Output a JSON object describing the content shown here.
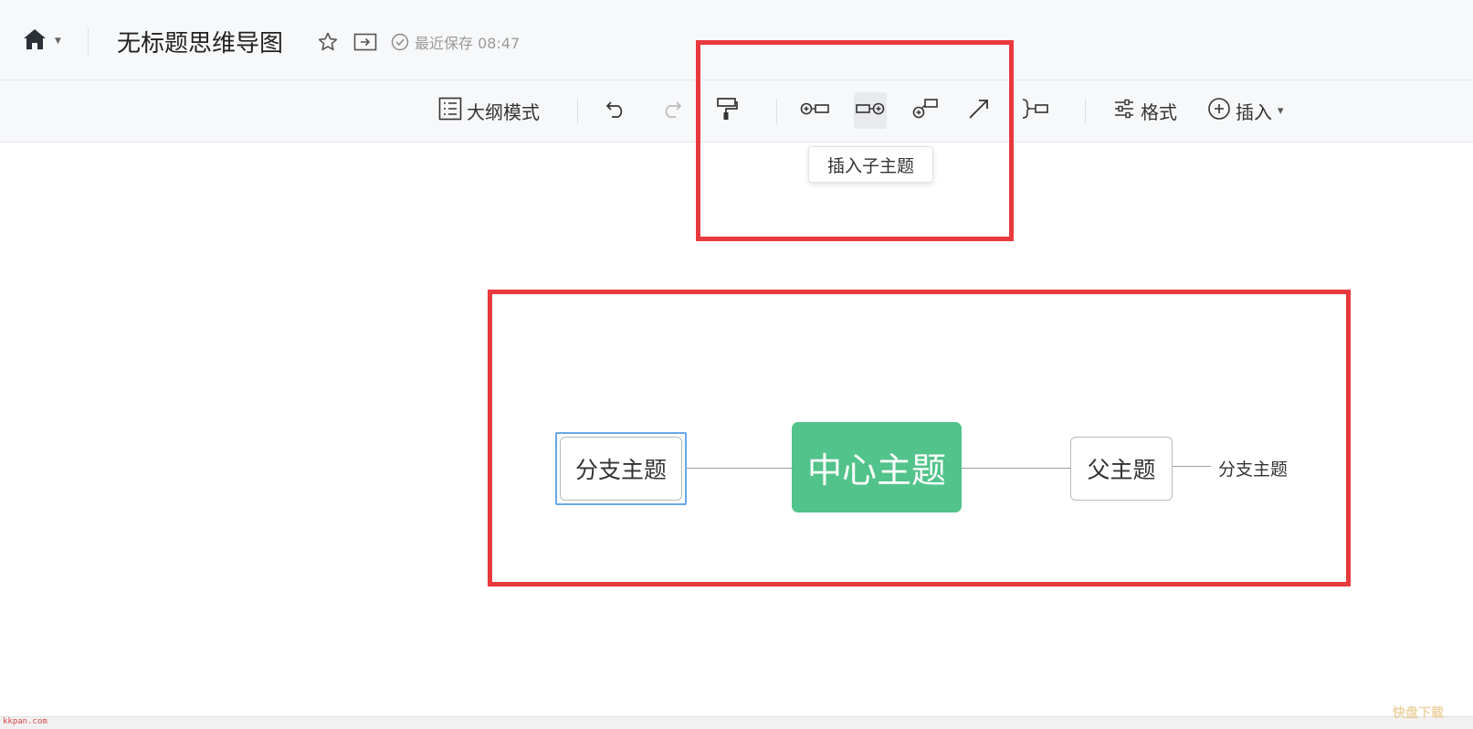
{
  "header": {
    "doc_title": "无标题思维导图",
    "save_status": "最近保存 08:47",
    "icons": [
      "home-icon",
      "chevron-down-icon",
      "star-icon",
      "move-to-folder-icon",
      "check-circle-icon"
    ]
  },
  "toolbar": {
    "outline_label": "大纲模式",
    "format_label": "格式",
    "insert_label": "插入",
    "insert_caret": "▾",
    "tooltip": "插入子主题",
    "icons": [
      "outline-icon",
      "undo-icon",
      "redo-icon",
      "format-painter-icon",
      "insert-parent-topic-icon",
      "insert-child-topic-icon",
      "insert-sibling-topic-icon",
      "relation-line-icon",
      "summary-icon",
      "format-settings-icon",
      "plus-circle-icon"
    ]
  },
  "mindmap": {
    "center_topic": "中心主题",
    "left_branch": "分支主题",
    "parent_topic": "父主题",
    "sub_branch": "分支主题"
  },
  "watermarks": {
    "left": "kkpan.com",
    "right": "快盘下载"
  },
  "colors": {
    "center_topic_bg": "#52c38a",
    "highlight_red": "#e8393d",
    "selection_blue": "#6aa8ea"
  }
}
